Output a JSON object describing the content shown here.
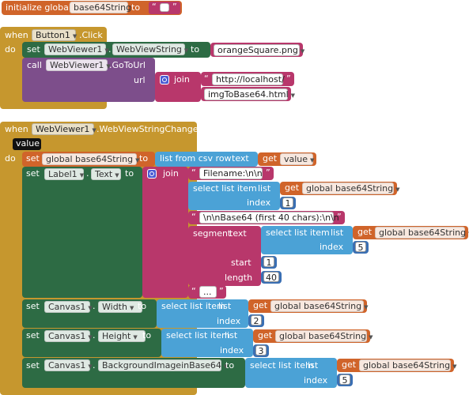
{
  "init": {
    "label_initialize": "initialize global",
    "var_name": "base64String",
    "label_to": "to"
  },
  "event1": {
    "label_when": "when",
    "component": "Button1",
    "event": ".Click",
    "label_do": "do",
    "set": {
      "label_set": "set",
      "component": "WebViewer1",
      "property": "WebViewString",
      "label_to": "to",
      "value": "orangeSquare.png"
    },
    "call": {
      "label_call": "call",
      "component": "WebViewer1",
      "method": ".GoToUrl",
      "label_url": "url",
      "label_join": "join",
      "part1": "http://localhost/",
      "part2": "imgToBase64.html"
    }
  },
  "event2": {
    "label_when": "when",
    "component": "WebViewer1",
    "event": ".WebViewStringChange",
    "param": "value",
    "label_do": "do",
    "set_global": {
      "label_set": "set",
      "var": "global base64String",
      "label_to": "to",
      "label_list_from_csv": "list from csv row",
      "label_text": "text",
      "label_get": "get",
      "get_var": "value"
    },
    "set_label": {
      "label_set": "set",
      "component": "Label1",
      "property": "Text",
      "label_to": "to",
      "label_join": "join",
      "str1": "Filename:\\n\\n",
      "select": {
        "label_select": "select list item",
        "label_list": "list",
        "label_get": "get",
        "var": "global base64String",
        "label_index": "index",
        "index": "1"
      },
      "str2": "\\n\\nBase64 (first 40 chars):\\n\\n",
      "segment": {
        "label_segment": "segment",
        "label_text": "text",
        "label_select": "select list item",
        "label_list": "list",
        "label_get": "get",
        "var": "global base64String",
        "label_index": "index",
        "index": "5",
        "label_start": "start",
        "start": "1",
        "label_length": "length",
        "length": "40"
      },
      "str3": "..."
    },
    "set_width": {
      "label_set": "set",
      "component": "Canvas1",
      "property": "Width",
      "label_to": "to",
      "label_select": "select list item",
      "label_list": "list",
      "label_get": "get",
      "var": "global base64String",
      "label_index": "index",
      "index": "2"
    },
    "set_height": {
      "label_set": "set",
      "component": "Canvas1",
      "property": "Height",
      "label_to": "to",
      "label_select": "select list item",
      "label_list": "list",
      "label_get": "get",
      "var": "global base64String",
      "label_index": "index",
      "index": "3"
    },
    "set_bg": {
      "label_set": "set",
      "component": "Canvas1",
      "property": "BackgroundImageinBase64",
      "label_to": "to",
      "label_select": "select list item",
      "label_list": "list",
      "label_get": "get",
      "var": "global base64String",
      "label_index": "index",
      "index": "5"
    }
  },
  "colors": {
    "event": "#c6972e",
    "variable": "#d0642a",
    "component_set": "#2d6b44",
    "component_call": "#7d4e8b",
    "text": "#b8376b",
    "list": "#4ba2d6",
    "math": "#3a6fb3"
  }
}
